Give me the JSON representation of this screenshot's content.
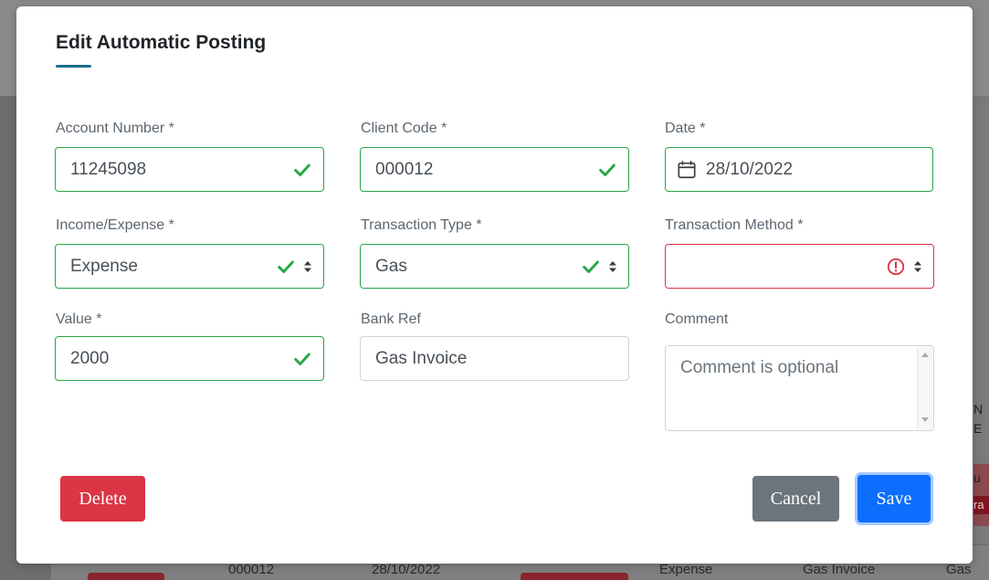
{
  "modal": {
    "title": "Edit Automatic Posting"
  },
  "required_mark": "*",
  "fields": {
    "account_number": {
      "label": "Account Number",
      "value": "11245098",
      "status": "valid"
    },
    "client_code": {
      "label": "Client Code",
      "value": "000012",
      "status": "valid"
    },
    "date": {
      "label": "Date",
      "value": "28/10/2022"
    },
    "income_expense": {
      "label": "Income/Expense",
      "value": "Expense",
      "status": "valid"
    },
    "transaction_type": {
      "label": "Transaction Type",
      "value": "Gas",
      "status": "valid"
    },
    "transaction_method": {
      "label": "Transaction Method",
      "value": "",
      "status": "invalid"
    },
    "value": {
      "label": "Value",
      "value": "2000",
      "status": "valid"
    },
    "bank_ref": {
      "label": "Bank Ref",
      "value": "Gas Invoice"
    },
    "comment": {
      "label": "Comment",
      "placeholder": "Comment is optional"
    }
  },
  "buttons": {
    "delete": "Delete",
    "cancel": "Cancel",
    "save": "Save"
  },
  "background_table": {
    "row": [
      "000012",
      "28/10/2022",
      "Expense",
      "Gas Invoice",
      "Gas"
    ]
  },
  "background_side": {
    "top": "N",
    "mid": "E",
    "lower": "u",
    "badge": "ra"
  },
  "colors": {
    "valid": "#28a745",
    "invalid": "#dc3545",
    "primary": "#0d6efd",
    "secondary": "#6c757d",
    "danger": "#dc3545",
    "title_accent": "#1a6e8e"
  },
  "icons": {
    "valid": "check-icon",
    "invalid": "alert-icon",
    "select": "sort-icon",
    "date": "calendar-icon"
  }
}
